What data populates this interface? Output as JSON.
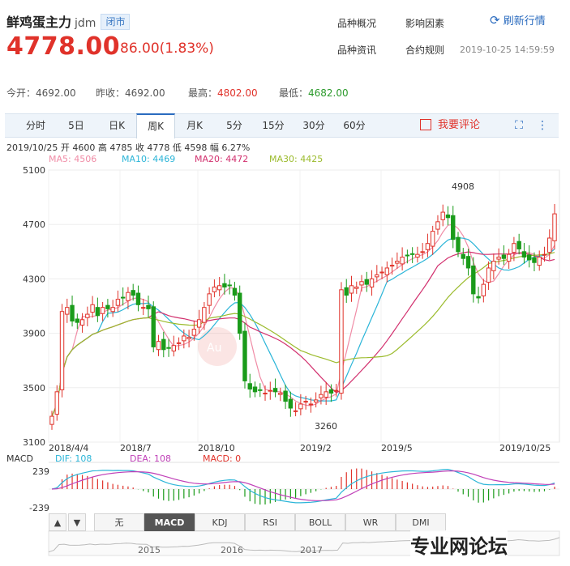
{
  "header": {
    "name": "鲜鸡蛋主力",
    "code": "jdm",
    "status": "闭市",
    "price": "4778.00",
    "change": "86.00(1.83%)",
    "links": [
      "品种概况",
      "影响因素",
      "品种资讯",
      "合约规则"
    ],
    "refresh": "刷新行情",
    "timestamp": "2019-10-25 14:59:59"
  },
  "quote": {
    "open_label": "今开：",
    "open": "4692.00",
    "prev_label": "昨收：",
    "prev": "4692.00",
    "high_label": "最高：",
    "high": "4802.00",
    "low_label": "最低：",
    "low": "4682.00"
  },
  "tabs": [
    "分时",
    "5日",
    "日K",
    "周K",
    "月K",
    "5分",
    "15分",
    "30分",
    "60分"
  ],
  "active_tab": "周K",
  "comment_label": "我要评论",
  "bar_info": "2019/10/25  开 4600  高 4785  收 4778  低 4598  幅 6.27%",
  "ma_labels": [
    {
      "text": "MA5: 4506",
      "color": "#f08ca6"
    },
    {
      "text": "MA10: 4469",
      "color": "#2bb5d8"
    },
    {
      "text": "MA20: 4472",
      "color": "#d2306e"
    },
    {
      "text": "MA30: 4425",
      "color": "#9bbb2c"
    }
  ],
  "macd_labels": {
    "title": "MACD",
    "dif": "DIF: 108",
    "dea": "DEA: 108",
    "macd": "MACD: 0"
  },
  "indicator_buttons": [
    "无",
    "MACD",
    "KDJ",
    "RSI",
    "BOLL",
    "WR",
    "DMI"
  ],
  "active_indicator": "MACD",
  "nav_years": [
    "2015",
    "2016",
    "2017"
  ],
  "watermark": "专业网论坛",
  "colors": {
    "up": "#e0322a",
    "down": "#1a9b1a",
    "accent": "#2a6bbf"
  },
  "chart_data": {
    "type": "candlestick",
    "ylim": [
      3100,
      5100
    ],
    "yticks": [
      3100,
      3500,
      3900,
      4300,
      4700,
      5100
    ],
    "xticks": [
      "2018/4/4",
      "2018/7",
      "2018/10",
      "2019/2",
      "2019/5",
      "2019/10/25"
    ],
    "annotations": [
      {
        "text": "4908",
        "value": 4908
      },
      {
        "text": "3260",
        "value": 3260
      }
    ],
    "macd_range": [
      "239",
      "-239"
    ],
    "macd_ylim": [
      -239,
      239
    ]
  }
}
